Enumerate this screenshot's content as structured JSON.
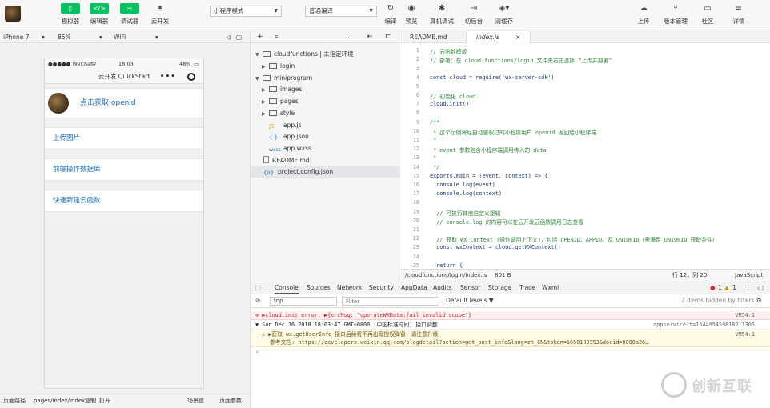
{
  "toolbar": {
    "simulator": "模拟器",
    "editor": "编辑器",
    "debugger": "调试器",
    "cloud": "云开发",
    "mode_select": "小程序模式",
    "compile_select": "普通编译",
    "compile": "编译",
    "preview": "预览",
    "real_debug": "真机调试",
    "background": "切后台",
    "clear_cache": "清缓存",
    "upload": "上传",
    "version": "版本管理",
    "community": "社区",
    "details": "详情"
  },
  "device": {
    "model": "iPhone 7",
    "zoom": "85%",
    "network": "WiFi"
  },
  "phone": {
    "carrier": "●●●●● WeChat",
    "wifi": "令",
    "time": "18:03",
    "battery": "48%",
    "nav_title": "云开发 QuickStart",
    "nav_dots": "•••",
    "get_openid": "点击获取 openid",
    "menu": [
      "上传图片",
      "前端操作数据库",
      "快速新建云函数"
    ]
  },
  "bottom": {
    "path_label": "页面路径",
    "path": "pages/index/index",
    "copy": "复制",
    "open": "打开",
    "scene": "场景值",
    "params": "页面参数"
  },
  "tree": {
    "nodes": [
      {
        "label": "cloudfunctions | 未指定环境"
      },
      {
        "label": "login"
      },
      {
        "label": "miniprogram"
      },
      {
        "label": "images"
      },
      {
        "label": "pages"
      },
      {
        "label": "style"
      },
      {
        "label": "app.js",
        "badge": "JS"
      },
      {
        "label": "app.json",
        "badge": "{ }"
      },
      {
        "label": "app.wxss",
        "badge": "wxss"
      },
      {
        "label": "README.md"
      },
      {
        "label": "project.config.json",
        "badge": "{o}"
      }
    ]
  },
  "editor": {
    "tabs": [
      "README.md",
      "index.js"
    ],
    "close": "×",
    "lines": [
      "// 云函数模板",
      "// 部署：在 cloud-functions/login 文件夹右击选择 “上传并部署”",
      "",
      "const cloud = require('wx-server-sdk')",
      "",
      "// 初始化 cloud",
      "cloud.init()",
      "",
      "/**",
      " * 这个示例将经自动鉴权过的小程序用户 openid 返回给小程序端",
      " *",
      " * event 参数包含小程序端调用传入的 data",
      " *",
      " */",
      "exports.main = (event, context) => {",
      "  console.log(event)",
      "  console.log(context)",
      "",
      "  // 可执行其他自定义逻辑",
      "  // console.log 的内容可以在云开发云函数调用日志查看",
      "",
      "  // 获取 WX Context (微信调用上下文)，包括 OPENID、APPID、及 UNIONID（需满足 UNIONID 获取条件）",
      "  const wxContext = cloud.getWXContext()",
      "",
      "  return {"
    ],
    "status": {
      "path": "/cloudfunctions/login/index.js",
      "size": "801 B",
      "pos": "行 12，列 20",
      "lang": "JavaScript"
    }
  },
  "console": {
    "tabs": [
      "Console",
      "Sources",
      "Network",
      "Security",
      "AppData",
      "Audits",
      "Sensor",
      "Storage",
      "Trace",
      "Wxml"
    ],
    "err_count": "1",
    "warn_count": "1",
    "context": "top",
    "filter_placeholder": "Filter",
    "levels": "Default levels ▼",
    "hidden": "2 items hidden by filters",
    "lines": [
      {
        "text": "▶cloud.init error: ▶{errMsg: \"operateWXData:fail invalid scope\"}",
        "right": "VM54:1"
      },
      {
        "text": "Sun Dec 16 2018 18:03:47 GMT+0800 (中国标准时间) 接口调整",
        "right": "appservice?t=1544954598182:1305"
      },
      {
        "text": "▶获取 wx.getUserInfo 接口后续将不再出现授权弹窗，请注意升级",
        "text2": "参考文档: https://developers.weixin.qq.com/blogdetail?action=get_post_info&lang=zh_CN&token=1650183953&docid=0000a26…",
        "right": "VM54:1"
      }
    ],
    "prompt": "›"
  },
  "watermark": {
    "text": "创新互联"
  }
}
